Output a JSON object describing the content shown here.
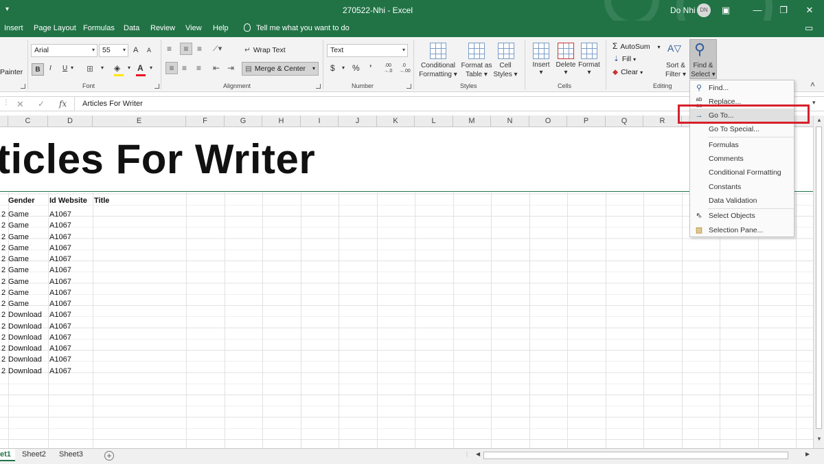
{
  "window": {
    "title": "270522-Nhi  -  Excel",
    "user_name": "Do Nhi",
    "user_initials": "DN"
  },
  "menu_tabs": [
    "Insert",
    "Page Layout",
    "Formulas",
    "Data",
    "Review",
    "View",
    "Help"
  ],
  "tell_me": "Tell me what you want to do",
  "ribbon": {
    "clipboard": {
      "format_painter": "Painter"
    },
    "font": {
      "name": "Arial",
      "size": "55",
      "grow": "A",
      "shrink": "A",
      "bold": "B",
      "italic": "I",
      "underline": "U",
      "label": "Font"
    },
    "alignment": {
      "wrap_text": "Wrap Text",
      "merge_center": "Merge & Center",
      "label": "Alignment"
    },
    "number": {
      "format": "Text",
      "currency": "$",
      "percent": "%",
      "comma": "’",
      "inc_decimal": ".00 →.0",
      "dec_decimal": ".0 →.00",
      "label": "Number"
    },
    "styles": {
      "conditional_formatting_1": "Conditional",
      "conditional_formatting_2": "Formatting",
      "format_table_1": "Format as",
      "format_table_2": "Table",
      "cell_styles_1": "Cell",
      "cell_styles_2": "Styles",
      "label": "Styles"
    },
    "cells": {
      "insert": "Insert",
      "delete": "Delete",
      "format": "Format",
      "label": "Cells"
    },
    "editing": {
      "autosum": "AutoSum",
      "fill": "Fill",
      "clear": "Clear",
      "sort_filter_1": "Sort &",
      "sort_filter_2": "Filter",
      "find_select_1": "Find &",
      "find_select_2": "Select",
      "label": "Editing"
    }
  },
  "formula_bar": {
    "content": "Articles For Writer"
  },
  "columns": [
    "C",
    "D",
    "E",
    "F",
    "G",
    "H",
    "I",
    "J",
    "K",
    "L",
    "M",
    "N",
    "O",
    "P",
    "Q",
    "R"
  ],
  "sheet": {
    "title": "ticles For Writer",
    "headers": {
      "gender": "Gender",
      "id_website": "Id Website",
      "title": "Title"
    },
    "rows": [
      {
        "left": "2",
        "gender": "Game",
        "id": "A1067"
      },
      {
        "left": "2",
        "gender": "Game",
        "id": "A1067"
      },
      {
        "left": "2",
        "gender": "Game",
        "id": "A1067"
      },
      {
        "left": "2",
        "gender": "Game",
        "id": "A1067"
      },
      {
        "left": "2",
        "gender": "Game",
        "id": "A1067"
      },
      {
        "left": "2",
        "gender": "Game",
        "id": "A1067"
      },
      {
        "left": "2",
        "gender": "Game",
        "id": "A1067"
      },
      {
        "left": "2",
        "gender": "Game",
        "id": "A1067"
      },
      {
        "left": "2",
        "gender": "Game",
        "id": "A1067"
      },
      {
        "left": "2",
        "gender": "Download",
        "id": "A1067"
      },
      {
        "left": "2",
        "gender": "Download",
        "id": "A1067"
      },
      {
        "left": "2",
        "gender": "Download",
        "id": "A1067"
      },
      {
        "left": "2",
        "gender": "Download",
        "id": "A1067"
      },
      {
        "left": "2",
        "gender": "Download",
        "id": "A1067"
      },
      {
        "left": "2",
        "gender": "Download",
        "id": "A1067"
      }
    ]
  },
  "sheet_tabs": [
    "et1",
    "Sheet2",
    "Sheet3"
  ],
  "find_menu": {
    "items": [
      {
        "label": "Find...",
        "icon": "magnifier-icon"
      },
      {
        "label": "Replace...",
        "icon": "replace-icon"
      },
      {
        "label": "Go To...",
        "icon": "arrow-right-icon"
      },
      {
        "label": "Go To Special...",
        "icon": ""
      },
      {
        "label": "Formulas",
        "icon": ""
      },
      {
        "label": "Comments",
        "icon": ""
      },
      {
        "label": "Conditional Formatting",
        "icon": ""
      },
      {
        "label": "Constants",
        "icon": ""
      },
      {
        "label": "Data Validation",
        "icon": ""
      },
      {
        "label": "Select Objects",
        "icon": "pointer-icon"
      },
      {
        "label": "Selection Pane...",
        "icon": "selection-pane-icon"
      }
    ]
  },
  "colors": {
    "excel_green": "#217346",
    "highlight_red": "#d6202a"
  }
}
